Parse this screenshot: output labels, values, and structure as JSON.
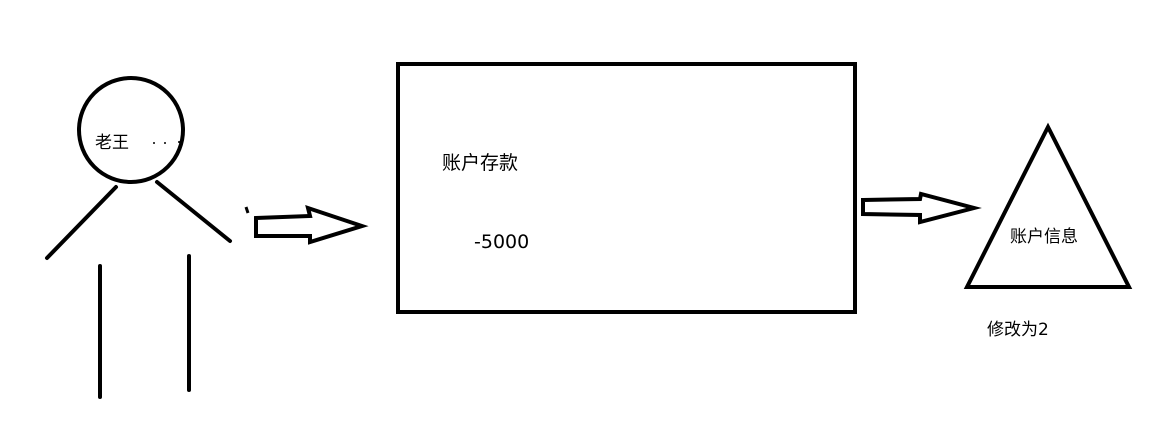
{
  "person": {
    "name": "老王"
  },
  "account_box": {
    "title": "账户存款",
    "amount": "-5000"
  },
  "account_info": {
    "label": "账户信息",
    "note": "修改为2"
  },
  "colors": {
    "stroke": "#000000",
    "background": "#ffffff"
  }
}
